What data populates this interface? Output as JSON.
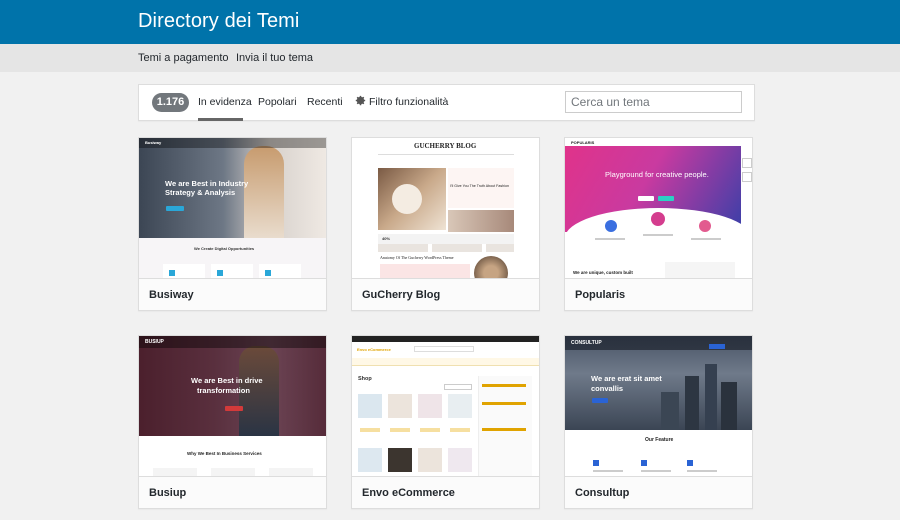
{
  "header": {
    "title": "Directory dei Temi"
  },
  "subnav": {
    "items": [
      "Temi a pagamento",
      "Invia il tuo tema"
    ]
  },
  "filters": {
    "count": "1.176",
    "tabs": [
      "In evidenza",
      "Popolari",
      "Recenti"
    ],
    "feature_filter": "Filtro funzionalità",
    "active_tab": "In evidenza",
    "search_placeholder": "Cerca un tema"
  },
  "themes": [
    {
      "name": "Busiway",
      "preview": {
        "logo": "Busiway",
        "hero_line1": "We are Best in Industry",
        "hero_line2": "Strategy & Analysis",
        "section_title": "We Create Digital Opportunities"
      }
    },
    {
      "name": "GuCherry Blog",
      "preview": {
        "logo": "GUCHERRY BLOG",
        "post_title": "I'll Give You The Truth About Fashion",
        "post_title2": "Anatomy Of The Gucherry WordPress Theme",
        "label": "40%"
      }
    },
    {
      "name": "Popularis",
      "preview": {
        "logo": "POPULARIS",
        "hero": "Playground for creative people.",
        "tagline": "We are unique, custom built"
      }
    },
    {
      "name": "Busiup",
      "preview": {
        "logo": "BUSIUP",
        "hero_line1": "We are Best in drive",
        "hero_line2": "transformation",
        "section_title": "Why We Best In Business Services"
      }
    },
    {
      "name": "Envo eCommerce",
      "preview": {
        "logo": "Envo eCommerce",
        "heading": "Shop"
      }
    },
    {
      "name": "Consultup",
      "preview": {
        "logo": "CONSULTUP",
        "hero_line1": "We are erat sit amet",
        "hero_line2": "convallis",
        "section_title": "Our Feature"
      }
    }
  ],
  "colors": {
    "header_bg": "#0073aa",
    "subnav_bg": "#e5e5e5",
    "page_bg": "#f1f1f1",
    "count_badge": "#72777c",
    "popularis_gradient_start": "#e0338a",
    "popularis_gradient_end": "#3a3fa8"
  },
  "icons": [
    "gear-icon"
  ]
}
